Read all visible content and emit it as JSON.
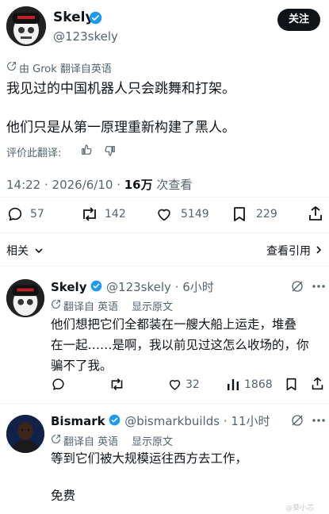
{
  "main_post": {
    "author_name": "Skely",
    "author_handle": "@123skely",
    "follow_label": "关注",
    "translation_note": "由 Grok 翻译自英语",
    "text_line1": "我见过的中国机器人只会跳舞和打架。",
    "text_line2": "他们只是从第一原理重新构建了黑人。",
    "rate_label": "评价此翻译:",
    "timestamp": "14:22 · 2026/6/10 · ",
    "views_count": "16万",
    "views_label": " 次查看",
    "stats": {
      "replies": "57",
      "reposts": "142",
      "likes": "5149",
      "bookmarks": "229"
    }
  },
  "sort_bar": {
    "relevant_label": "相关",
    "view_quotes_label": "查看引用"
  },
  "replies": [
    {
      "author_name": "Skely",
      "author_handle": "@123skely",
      "time": "· 6小时",
      "translated_from": "翻译自 英语",
      "show_original": "显示原文",
      "text_line1": "他们想把它们全都装在一艘大船上运走，堆叠",
      "text_line2": "在一起……是啊，我以前见过这怎么收场的，你",
      "text_line3": "骗不了我。",
      "stats": {
        "likes": "32",
        "views": "1868"
      }
    },
    {
      "author_name": "Bismark",
      "author_handle": "@bismarkbuilds",
      "time": "· 11小时",
      "translated_from": "翻译自 英语",
      "show_original": "显示原文",
      "text_line1": "等到它们被大规模运往西方去工作，",
      "text_line2": "免费"
    }
  ],
  "watermark": "@葵小芯",
  "colors": {
    "accent": "#1d9bf0",
    "text": "#0f1419",
    "muted": "#536471"
  }
}
